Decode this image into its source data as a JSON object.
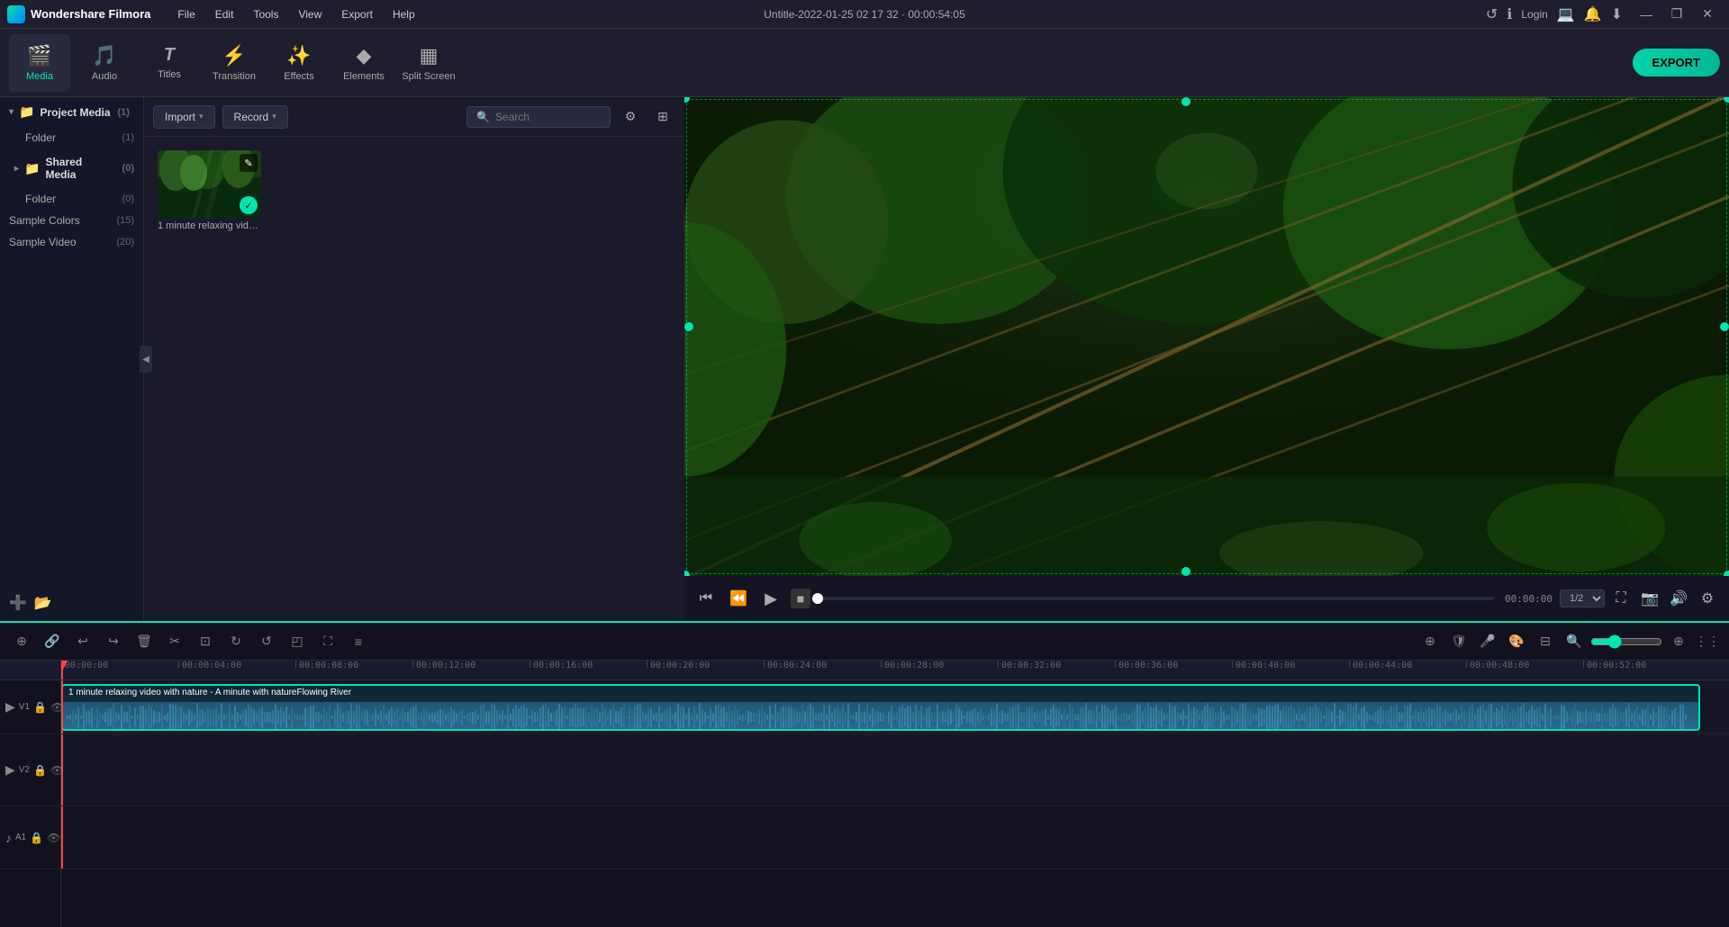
{
  "app": {
    "name": "Wondershare Filmora",
    "logo_text": "Wondershare Filmora"
  },
  "title_bar": {
    "project_title": "Untitle-2022-01-25 02 17 32 · 00:00:54:05",
    "menu_items": [
      "File",
      "Edit",
      "Tools",
      "View",
      "Export",
      "Help"
    ],
    "window_buttons": [
      "—",
      "❐",
      "✕"
    ]
  },
  "toolbar": {
    "items": [
      {
        "id": "media",
        "icon": "🎬",
        "label": "Media",
        "active": true
      },
      {
        "id": "audio",
        "icon": "🎵",
        "label": "Audio",
        "active": false
      },
      {
        "id": "titles",
        "icon": "T",
        "label": "Titles",
        "active": false
      },
      {
        "id": "transition",
        "icon": "⚡",
        "label": "Transition",
        "active": false
      },
      {
        "id": "effects",
        "icon": "✨",
        "label": "Effects",
        "active": false
      },
      {
        "id": "elements",
        "icon": "◆",
        "label": "Elements",
        "active": false
      },
      {
        "id": "split-screen",
        "icon": "▦",
        "label": "Split Screen",
        "active": false
      }
    ],
    "export_label": "EXPORT"
  },
  "left_panel": {
    "section_title": "Project Media",
    "section_count": "(1)",
    "items": [
      {
        "label": "Folder",
        "count": "(1)"
      },
      {
        "label": "Shared Media",
        "count": "(0)"
      },
      {
        "label": "Folder",
        "count": "(0)"
      },
      {
        "label": "Sample Colors",
        "count": "(15)"
      },
      {
        "label": "Sample Video",
        "count": "(20)"
      }
    ]
  },
  "media_panel": {
    "import_label": "Import",
    "record_label": "Record",
    "search_placeholder": "Search",
    "media_items": [
      {
        "label": "1 minute relaxing video ...",
        "type": "video"
      }
    ]
  },
  "preview": {
    "time": "00:00:00",
    "quality": "1/2",
    "total_time": "00:00:00"
  },
  "timeline": {
    "ruler_marks": [
      "00:00:00",
      "00:00:04:00",
      "00:00:08:00",
      "00:00:12:00",
      "00:00:16:00",
      "00:00:20:00",
      "00:00:24:00",
      "00:00:28:00",
      "00:00:32:00",
      "00:00:36:00",
      "00:00:40:00",
      "00:00:44:00",
      "00:00:48:00",
      "00:00:52:00"
    ],
    "tracks": [
      {
        "id": "video1",
        "type": "video",
        "label": "V1"
      },
      {
        "id": "video2",
        "type": "video",
        "label": "V2"
      },
      {
        "id": "audio1",
        "type": "audio",
        "label": "A1"
      }
    ],
    "clip_label": "1 minute relaxing video with nature - A minute with natureFlowing River"
  }
}
